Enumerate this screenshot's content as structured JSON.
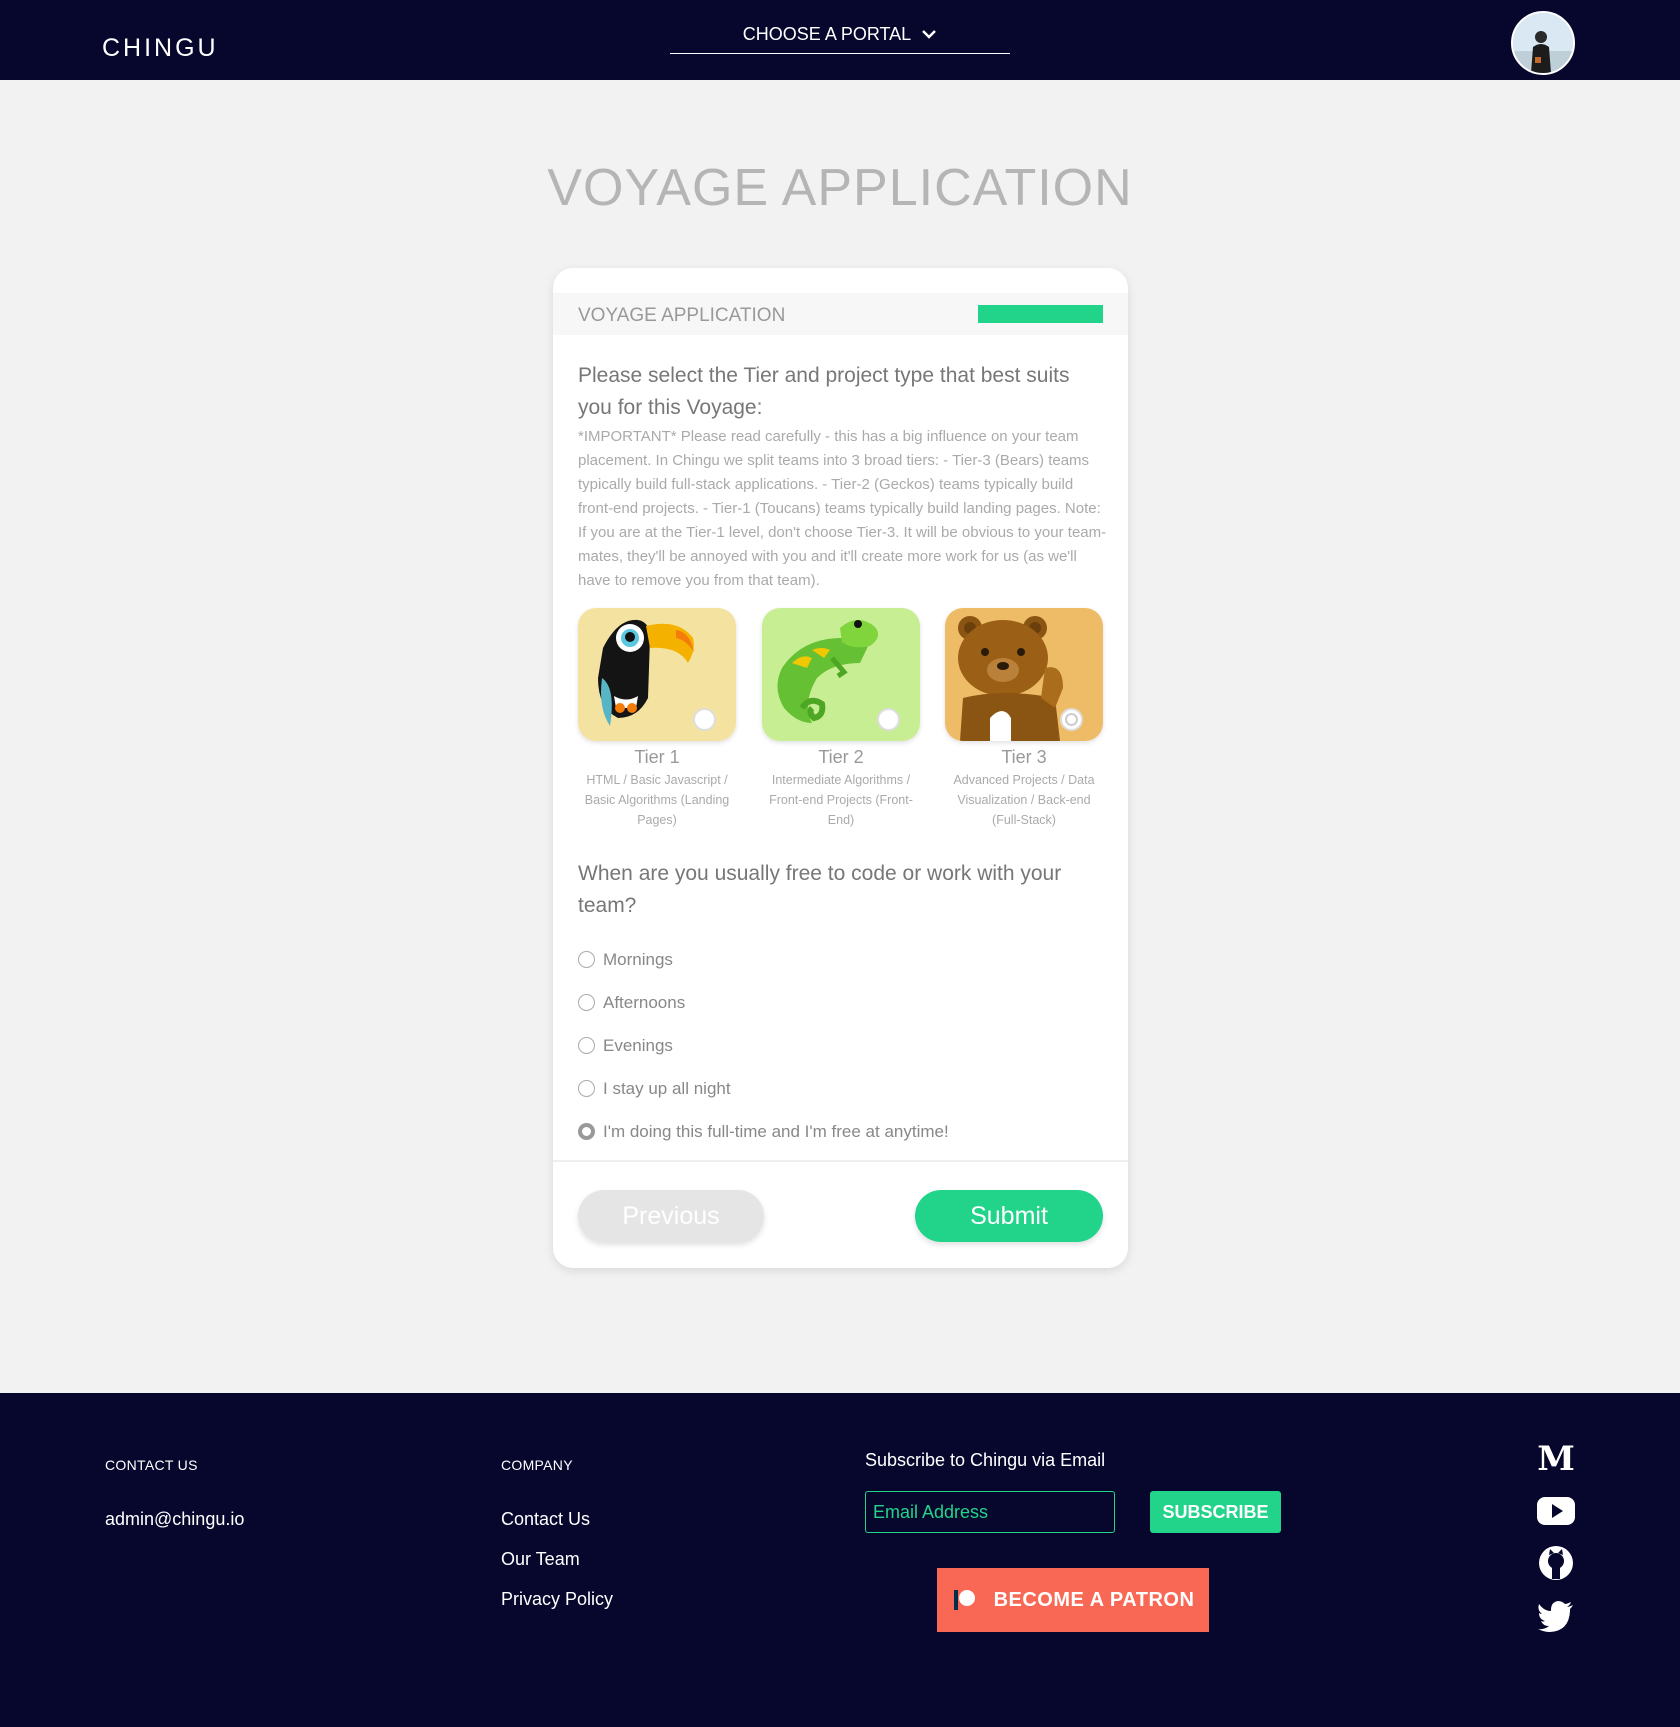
{
  "header": {
    "logo": "CHINGU",
    "portal_label": "CHOOSE A PORTAL"
  },
  "main": {
    "page_title": "VOYAGE APPLICATION",
    "card_title": "VOYAGE APPLICATION",
    "progress_fraction": 1.0,
    "question1": "Please select the Tier and project type that best suits you for this Voyage:",
    "note": "*IMPORTANT* Please read carefully - this has a big influence on your team placement. In Chingu we split teams into 3 broad tiers: - Tier-3 (Bears) teams typically build full-stack applications. - Tier-2 (Geckos) teams typically build front-end projects. - Tier-1 (Toucans) teams typically build landing pages. Note: If you are at the Tier-1 level, don't choose Tier-3. It will be obvious to your team-mates, they'll be annoyed with you and it'll create more work for us (as we'll have to remove you from that team).",
    "tiers": [
      {
        "name": "Tier 1",
        "desc": "HTML / Basic Javascript / Basic Algorithms (Landing Pages)",
        "selected": false
      },
      {
        "name": "Tier 2",
        "desc": "Intermediate Algorithms / Front-end Projects (Front-End)",
        "selected": false
      },
      {
        "name": "Tier 3",
        "desc": "Advanced Projects / Data Visualization / Back-end (Full-Stack)",
        "selected": true
      }
    ],
    "question2": "When are you usually free to code or work with your team?",
    "options": [
      {
        "label": "Mornings",
        "checked": false
      },
      {
        "label": "Afternoons",
        "checked": false
      },
      {
        "label": "Evenings",
        "checked": false
      },
      {
        "label": "I stay up all night",
        "checked": false
      },
      {
        "label": "I'm doing this full-time and I'm free at anytime!",
        "checked": true
      }
    ],
    "previous_label": "Previous",
    "submit_label": "Submit"
  },
  "footer": {
    "contact_heading": "CONTACT US",
    "contact_email": "admin@chingu.io",
    "company_heading": "COMPANY",
    "company_links": [
      "Contact Us",
      "Our Team",
      "Privacy Policy"
    ],
    "subscribe_title": "Subscribe to Chingu via Email",
    "email_placeholder": "Email Address",
    "subscribe_label": "SUBSCRIBE",
    "patron_label": "BECOME A PATRON",
    "social_icons": [
      "medium-icon",
      "youtube-icon",
      "github-icon",
      "twitter-icon"
    ]
  },
  "colors": {
    "navy": "#07072e",
    "accent": "#22d38a",
    "patron": "#f96854"
  }
}
